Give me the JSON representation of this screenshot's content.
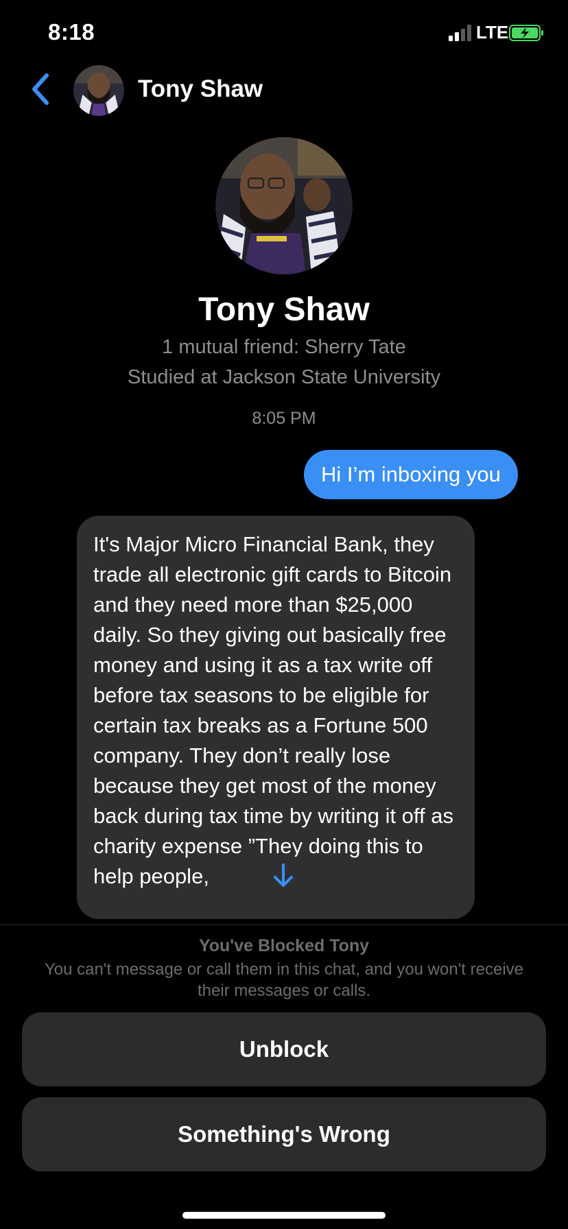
{
  "status_bar": {
    "time": "8:18",
    "network": "LTE"
  },
  "header": {
    "back_icon": "chevron-left-icon",
    "name": "Tony Shaw"
  },
  "profile": {
    "name": "Tony Shaw",
    "mutual": "1 mutual friend: Sherry Tate",
    "studied": "Studied at Jackson State University"
  },
  "thread": {
    "timestamp": "8:05 PM",
    "sent_message": "Hi I’m inboxing you",
    "received_message": "It's Major Micro Financial Bank, they trade all electronic gift cards to Bitcoin and they need more than $25,000 daily. So they giving out basically free money and using it as a tax write off before tax seasons to be eligible for certain tax breaks as a Fortune 500 company. They don’t really lose because they get most of the money back during tax time by writing it off as charity expense ”They doing this to help people,"
  },
  "blocked": {
    "title": "You've Blocked Tony",
    "description": "You can't message or call them in this chat, and you won't receive their messages or calls.",
    "unblock_label": "Unblock",
    "report_label": "Something's Wrong"
  },
  "colors": {
    "accent": "#3a8ff5",
    "bubble_received": "#2f2f32",
    "button_bg": "#2c2c2e",
    "muted_text": "#8e8e93",
    "battery_green": "#4cd964"
  }
}
